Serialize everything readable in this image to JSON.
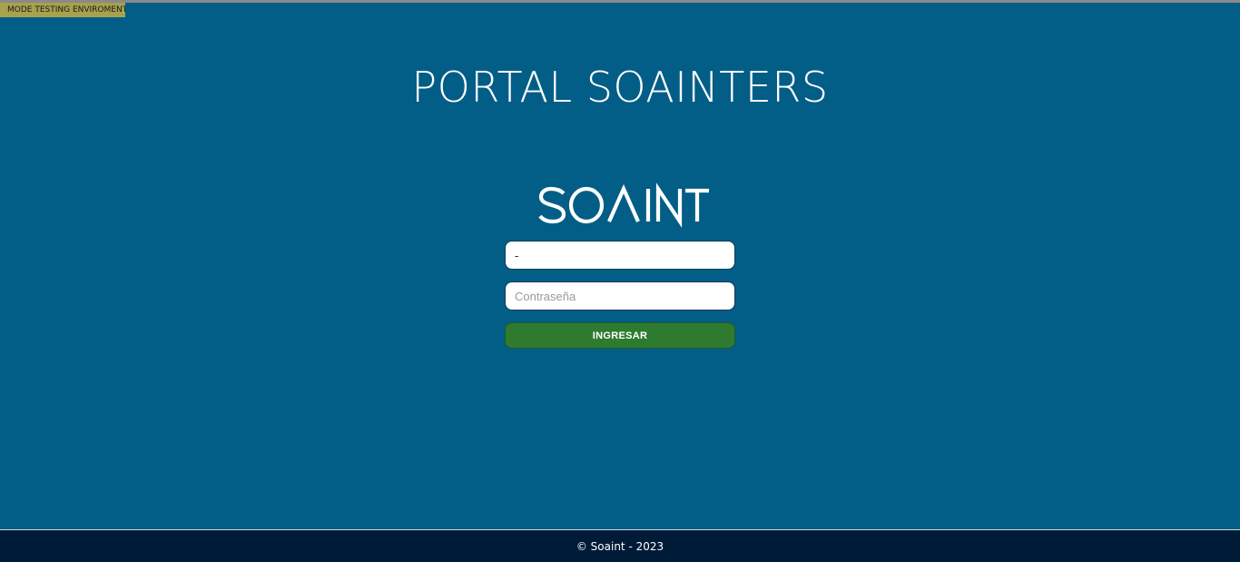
{
  "environment_badge": "MODE TESTING ENVIROMENT",
  "title": "PORTAL SOAINTERS",
  "logo": {
    "name": "soaint-logo",
    "text": "SOAINT",
    "color": "#ffffff"
  },
  "login_form": {
    "username": {
      "value": "-",
      "placeholder": ""
    },
    "password": {
      "value": "",
      "placeholder": "Contraseña"
    },
    "submit_label": "INGRESAR"
  },
  "footer": {
    "text": "© Soaint - 2023"
  },
  "colors": {
    "background": "#035e87",
    "badge": "#a8a14d",
    "button": "#2e7b30",
    "footer": "#001b38"
  }
}
